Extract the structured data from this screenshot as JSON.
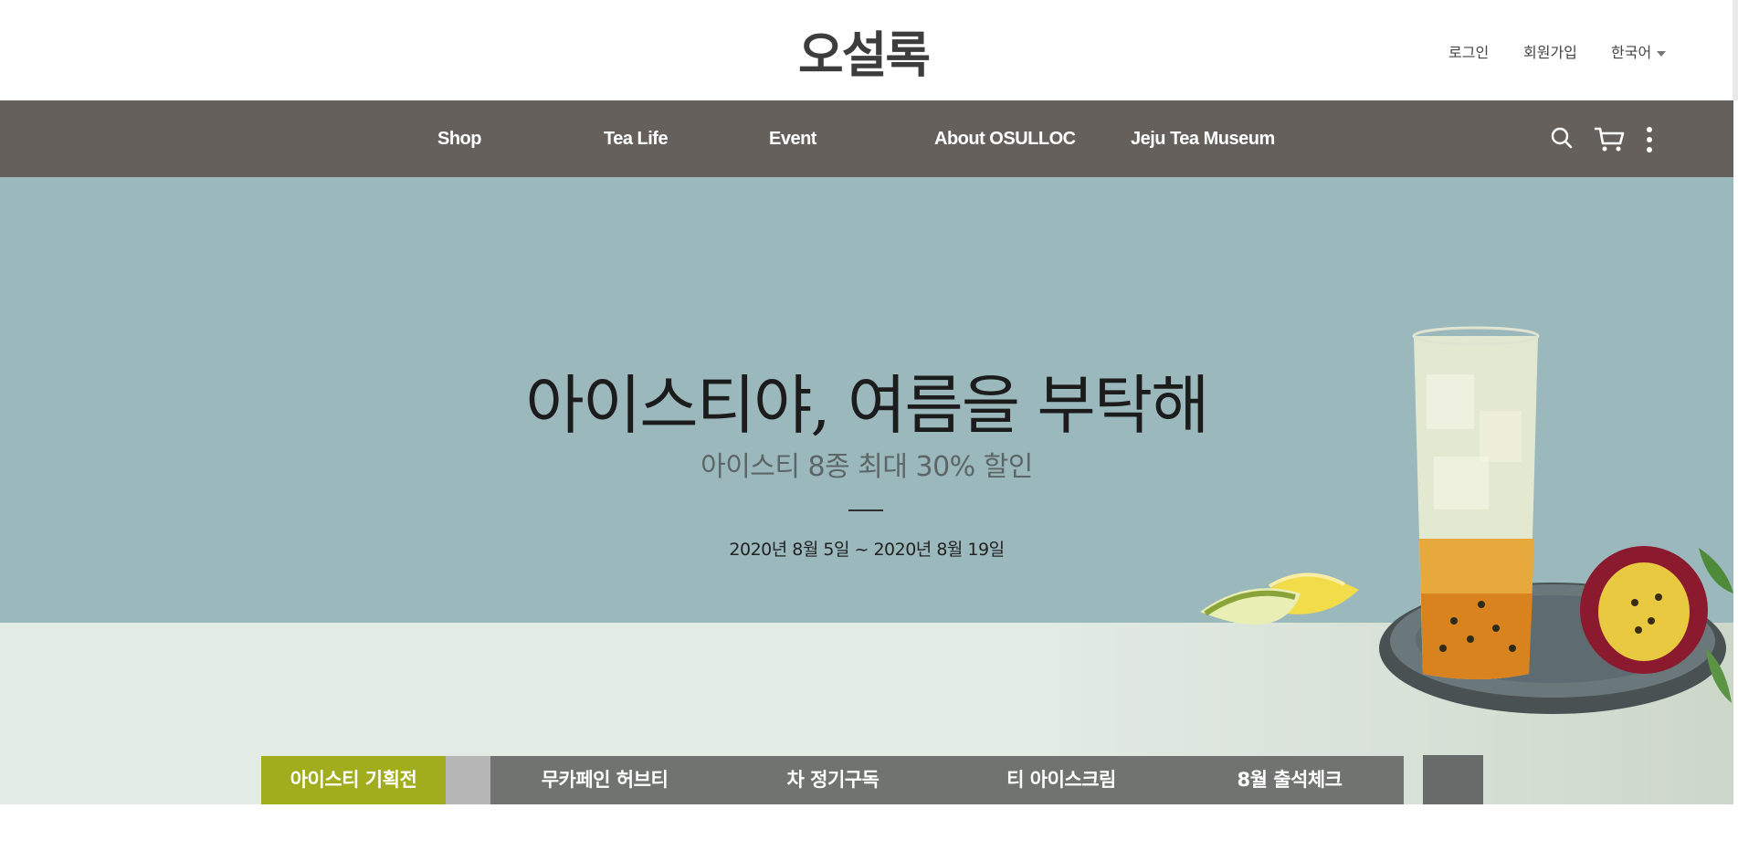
{
  "header": {
    "logo": "오설록",
    "login": "로그인",
    "signup": "회원가입",
    "language": "한국어"
  },
  "nav": {
    "items": [
      "Shop",
      "Tea Life",
      "Event",
      "About OSULLOC",
      "Jeju Tea Museum"
    ],
    "icons": [
      "search-icon",
      "cart-icon",
      "more-vertical-icon"
    ]
  },
  "hero": {
    "title": "아이스티야, 여름을 부탁해",
    "subtitle": "아이스티 8종 최대 30% 할인",
    "date": "2020년 8월 5일 ~ 2020년 8월 19일"
  },
  "tabs": {
    "items": [
      "아이스티 기획전",
      "무카페인 허브티",
      "차 정기구독",
      "티 아이스크림",
      "8월 출석체크"
    ],
    "active_index": 0
  },
  "colors": {
    "nav_bg": "#66605c",
    "hero_bg": "#9bb9bd",
    "tab_active": "#a2ad1e",
    "tab_bg": "#707370"
  }
}
